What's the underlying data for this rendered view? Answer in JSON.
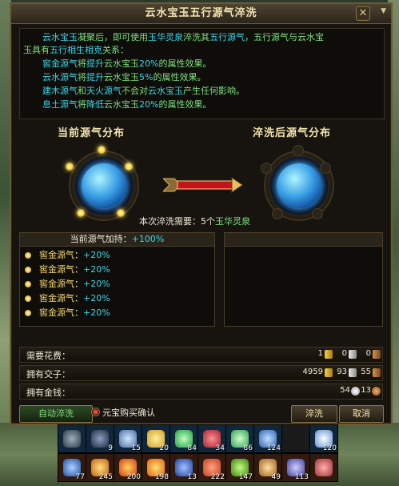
{
  "window": {
    "title": "云水宝玉五行源气淬洗",
    "close_glyph": "✕",
    "menu_glyph": "▼"
  },
  "description": {
    "line1_a": "云水宝玉",
    "line1_b": "凝聚后，即可使用",
    "line1_c": "玉华灵泉",
    "line1_d": "淬洗其",
    "line1_e": "五行源气",
    "line1_f": "，五行源气与云水宝",
    "line2_a": "玉具有",
    "line2_b": "五行相生相克",
    "line2_c": "关系：",
    "line3_a": "窖金源气",
    "line3_b": "将",
    "line3_c": "提升",
    "line3_d": "云水宝玉",
    "line3_e": "20%",
    "line3_f": "的属性效果。",
    "line4_a": "云水源气",
    "line4_b": "将",
    "line4_c": "提升",
    "line4_d": "云水宝玉",
    "line4_e": "5%",
    "line4_f": "的属性效果。",
    "line5_a": "建木源气",
    "line5_b": "和",
    "line5_c": "天火源气",
    "line5_d": "不会对",
    "line5_e": "云水宝玉",
    "line5_f": "产生任何影响。",
    "line6_a": "息土源气",
    "line6_b": "将",
    "line6_c": "降低",
    "line6_d": "云水宝玉",
    "line6_e": "20%",
    "line6_f": "的属性效果。"
  },
  "current_heading": "当前源气分布",
  "after_heading": "淬洗后源气分布",
  "need": {
    "prefix": "本次淬洗需要：",
    "amount": "5个",
    "item": "玉华灵泉"
  },
  "current_panel": {
    "header_label": "当前源气加持：",
    "header_value": "+100%",
    "rows": [
      {
        "name": "窖金源气",
        "sep": "：",
        "value": "+20%"
      },
      {
        "name": "窖金源气",
        "sep": "：",
        "value": "+20%"
      },
      {
        "name": "窖金源气",
        "sep": "：",
        "value": "+20%"
      },
      {
        "name": "窖金源气",
        "sep": "：",
        "value": "+20%"
      },
      {
        "name": "窖金源气",
        "sep": "：",
        "value": "+20%"
      }
    ]
  },
  "costs": {
    "required_label": "需要花费：",
    "required_gold": "1",
    "required_silver": "0",
    "required_bronze": "0",
    "owned_jiaozi_label": "拥有交子：",
    "owned_gold": "4959",
    "owned_silver": "93",
    "owned_bronze": "55",
    "owned_money_label": "拥有金钱：",
    "money_silver": "54",
    "money_bronze": "13"
  },
  "buttons": {
    "auto": "自动淬洗",
    "yuanbao_confirm": "元宝购买确认",
    "wash": "淬洗",
    "cancel": "取消"
  },
  "inventory": {
    "row1": [
      "",
      "9",
      "15",
      "20",
      "84",
      "34",
      "86",
      "124",
      "",
      "120"
    ],
    "row2": [
      "77",
      "245",
      "200",
      "198",
      "13",
      "222",
      "147",
      "49",
      "113",
      ""
    ]
  },
  "colors": {
    "gold_text": "#f5d96a",
    "green_text": "#7fe07f",
    "cyan_text": "#38d6e8",
    "red_text": "#ff4a3a"
  }
}
